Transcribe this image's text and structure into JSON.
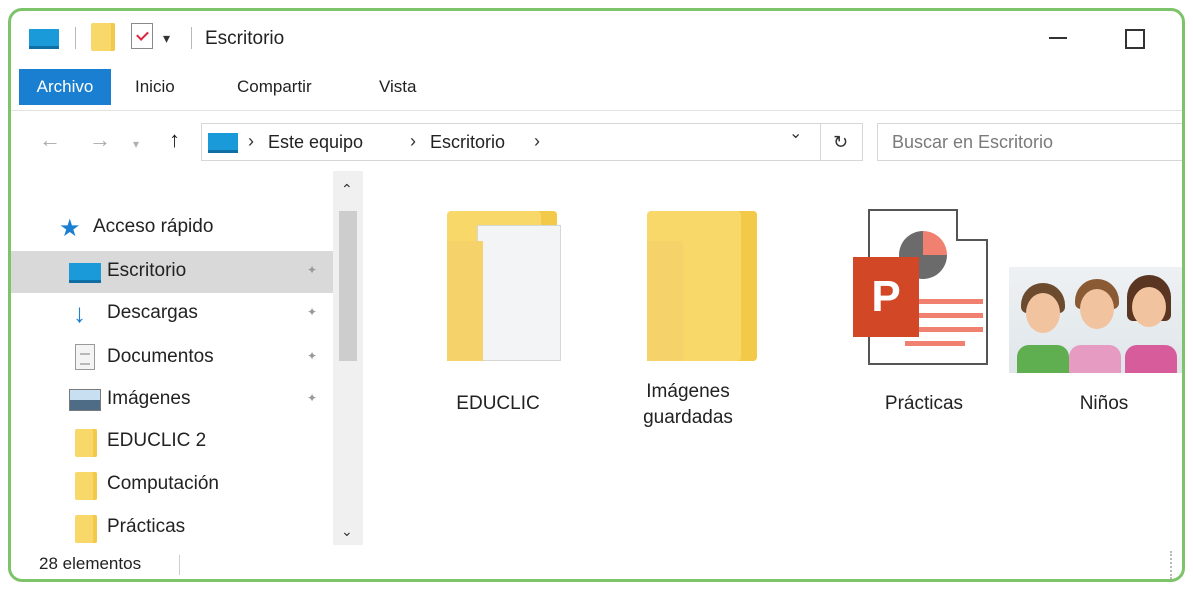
{
  "window": {
    "title": "Escritorio",
    "quick_access_dropdown": "▾",
    "minimize_label": "Minimizar",
    "maximize_label": "Maximizar"
  },
  "ribbon": {
    "tabs": [
      {
        "label": "Archivo",
        "active": true
      },
      {
        "label": "Inicio"
      },
      {
        "label": "Compartir"
      },
      {
        "label": "Vista"
      }
    ]
  },
  "navigation": {
    "back": "←",
    "forward": "→",
    "recent": "▾",
    "up": "↑",
    "chevron": "›",
    "breadcrumbs": [
      "Este equipo",
      "Escritorio"
    ],
    "address_dropdown": "⌄",
    "refresh": "↻",
    "search_placeholder": "Buscar en Escritorio"
  },
  "sidebar": {
    "items": [
      {
        "label": "Acceso rápido",
        "icon": "star-icon"
      },
      {
        "label": "Escritorio",
        "icon": "desktop-icon",
        "pinned": true,
        "selected": true
      },
      {
        "label": "Descargas",
        "icon": "download-icon",
        "pinned": true
      },
      {
        "label": "Documentos",
        "icon": "document-icon",
        "pinned": true
      },
      {
        "label": "Imágenes",
        "icon": "images-icon",
        "pinned": true
      },
      {
        "label": "EDUCLIC 2",
        "icon": "folder-icon"
      },
      {
        "label": "Computación",
        "icon": "folder-icon"
      },
      {
        "label": "Prácticas",
        "icon": "folder-icon"
      }
    ],
    "pin_glyph": "✦",
    "scroll_up": "⌃",
    "scroll_down": "⌄"
  },
  "content": {
    "items": [
      {
        "label": "EDUCLIC",
        "icon": "folder-with-documents-icon"
      },
      {
        "label": "Imágenes\nguardadas",
        "icon": "folder-icon"
      },
      {
        "label": "Prácticas",
        "icon": "powerpoint-file-icon",
        "badge": "P"
      },
      {
        "label": "Niños",
        "icon": "photo-thumbnail-icon"
      }
    ]
  },
  "status": {
    "count": "28 elementos"
  },
  "colors": {
    "frame_border": "#7cc36a",
    "accent_blue": "#1a7fd0",
    "folder_yellow": "#f9d86a",
    "powerpoint_red": "#d24726",
    "selected_bg": "#d9d9d9"
  }
}
